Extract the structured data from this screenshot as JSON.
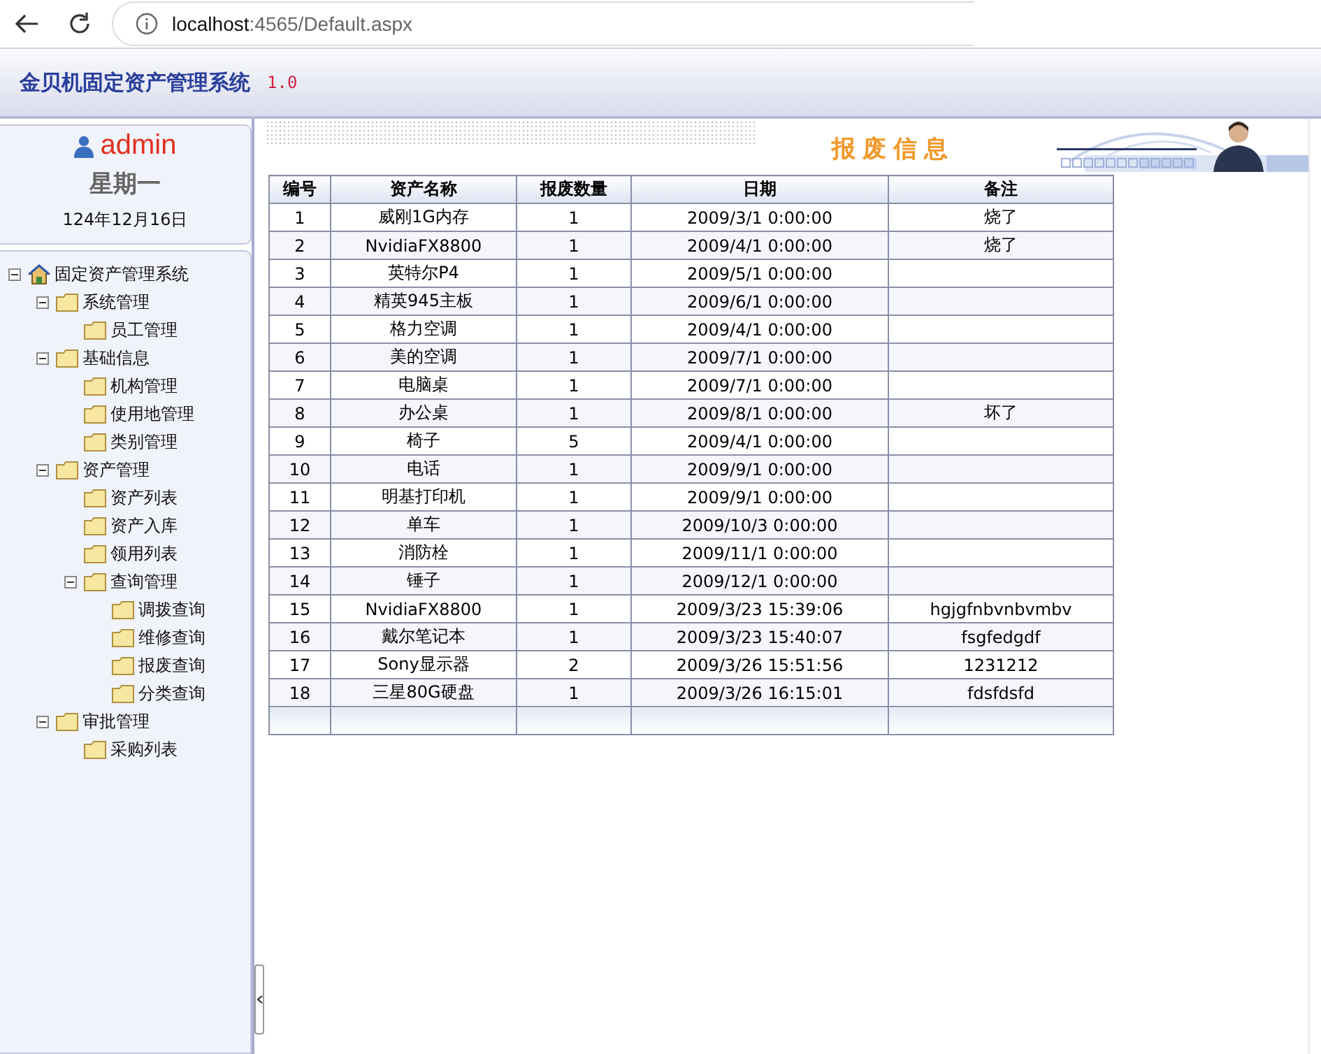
{
  "browser": {
    "url_host": "localhost",
    "url_path": ":4565/Default.aspx"
  },
  "header": {
    "title": "金贝机固定资产管理系统",
    "version": "1.0"
  },
  "user": {
    "name": "admin",
    "weekday": "星期一",
    "date": "124年12月16日"
  },
  "tree": {
    "label": "固定资产管理系统",
    "expanded": true,
    "children": [
      {
        "label": "系统管理",
        "expanded": true,
        "children": [
          {
            "label": "员工管理"
          }
        ]
      },
      {
        "label": "基础信息",
        "expanded": true,
        "children": [
          {
            "label": "机构管理"
          },
          {
            "label": "使用地管理"
          },
          {
            "label": "类别管理"
          }
        ]
      },
      {
        "label": "资产管理",
        "expanded": true,
        "children": [
          {
            "label": "资产列表"
          },
          {
            "label": "资产入库"
          },
          {
            "label": "领用列表"
          },
          {
            "label": "查询管理",
            "expanded": true,
            "children": [
              {
                "label": "调拨查询"
              },
              {
                "label": "维修查询"
              },
              {
                "label": "报废查询"
              },
              {
                "label": "分类查询"
              }
            ]
          }
        ]
      },
      {
        "label": "审批管理",
        "expanded": true,
        "children": [
          {
            "label": "采购列表"
          }
        ]
      }
    ]
  },
  "page_title": "报废信息",
  "table": {
    "columns": [
      "编号",
      "资产名称",
      "报废数量",
      "日期",
      "备注"
    ],
    "rows": [
      [
        "1",
        "威刚1G内存",
        "1",
        "2009/3/1 0:00:00",
        "烧了"
      ],
      [
        "2",
        "NvidiaFX8800",
        "1",
        "2009/4/1 0:00:00",
        "烧了"
      ],
      [
        "3",
        "英特尔P4",
        "1",
        "2009/5/1 0:00:00",
        ""
      ],
      [
        "4",
        "精英945主板",
        "1",
        "2009/6/1 0:00:00",
        ""
      ],
      [
        "5",
        "格力空调",
        "1",
        "2009/4/1 0:00:00",
        ""
      ],
      [
        "6",
        "美的空调",
        "1",
        "2009/7/1 0:00:00",
        ""
      ],
      [
        "7",
        "电脑桌",
        "1",
        "2009/7/1 0:00:00",
        ""
      ],
      [
        "8",
        "办公桌",
        "1",
        "2009/8/1 0:00:00",
        "坏了"
      ],
      [
        "9",
        "椅子",
        "5",
        "2009/4/1 0:00:00",
        ""
      ],
      [
        "10",
        "电话",
        "1",
        "2009/9/1 0:00:00",
        ""
      ],
      [
        "11",
        "明基打印机",
        "1",
        "2009/9/1 0:00:00",
        ""
      ],
      [
        "12",
        "单车",
        "1",
        "2009/10/3 0:00:00",
        ""
      ],
      [
        "13",
        "消防栓",
        "1",
        "2009/11/1 0:00:00",
        ""
      ],
      [
        "14",
        "锤子",
        "1",
        "2009/12/1 0:00:00",
        ""
      ],
      [
        "15",
        "NvidiaFX8800",
        "1",
        "2009/3/23 15:39:06",
        "hgjgfnbvnbvmbv"
      ],
      [
        "16",
        "戴尔笔记本",
        "1",
        "2009/3/23 15:40:07",
        "fsgfedgdf"
      ],
      [
        "17",
        "Sony显示器",
        "2",
        "2009/3/26 15:51:56",
        "1231212"
      ],
      [
        "18",
        "三星80G硬盘",
        "1",
        "2009/3/26 16:15:01",
        "fdsfdsfd"
      ]
    ]
  }
}
